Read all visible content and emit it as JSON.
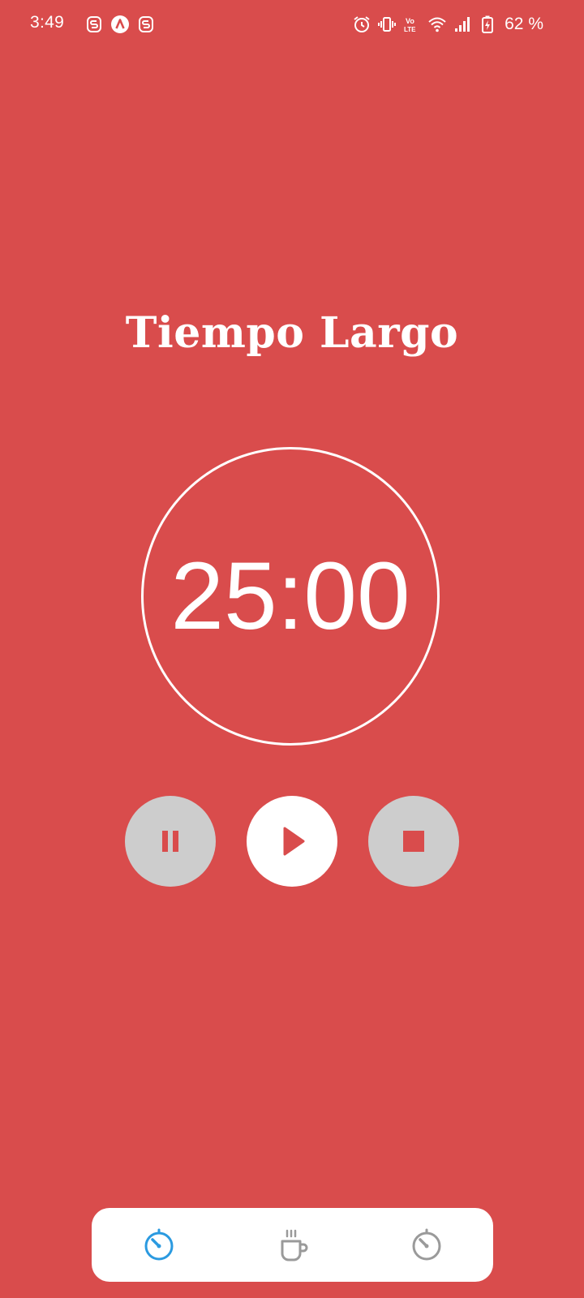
{
  "status_bar": {
    "time": "3:49",
    "battery": "62 %",
    "left_icons": [
      "notification-s-icon",
      "app-a-icon",
      "notification-s-icon"
    ],
    "right_icons": [
      "alarm-icon",
      "vibrate-icon",
      "volte-icon",
      "wifi-icon",
      "signal-icon",
      "battery-charging-icon"
    ]
  },
  "screen": {
    "title": "Tiempo Largo",
    "timer": "25:00"
  },
  "controls": {
    "pause_icon": "pause-icon",
    "play_icon": "play-icon",
    "stop_icon": "stop-icon"
  },
  "bottom_nav": {
    "items": [
      {
        "icon": "timer-icon",
        "active": true
      },
      {
        "icon": "coffee-cup-icon",
        "active": false
      },
      {
        "icon": "timer-icon",
        "active": false
      }
    ]
  },
  "colors": {
    "background": "#d94c4c",
    "button_inactive": "#cdcdcd",
    "nav_active": "#2b9ae0",
    "nav_inactive": "#9a9a9a"
  }
}
